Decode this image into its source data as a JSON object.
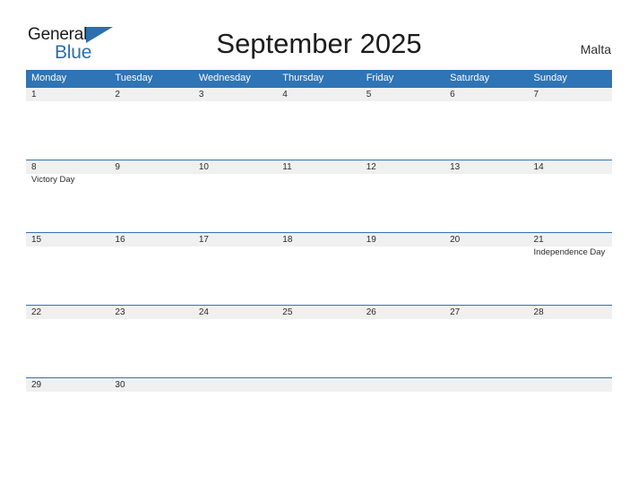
{
  "logo": {
    "word_one": "General",
    "word_two": "Blue",
    "triangle_icon": "triangle-icon",
    "brand_blue": "#2b6fad"
  },
  "header": {
    "title": "September 2025",
    "region": "Malta"
  },
  "colors": {
    "header_blue": "#2f74b5",
    "band_gray": "#f0f0f0",
    "text": "#2b2b2b"
  },
  "calendar": {
    "weekdays": [
      "Monday",
      "Tuesday",
      "Wednesday",
      "Thursday",
      "Friday",
      "Saturday",
      "Sunday"
    ],
    "weeks": [
      [
        {
          "day": "1",
          "event": ""
        },
        {
          "day": "2",
          "event": ""
        },
        {
          "day": "3",
          "event": ""
        },
        {
          "day": "4",
          "event": ""
        },
        {
          "day": "5",
          "event": ""
        },
        {
          "day": "6",
          "event": ""
        },
        {
          "day": "7",
          "event": ""
        }
      ],
      [
        {
          "day": "8",
          "event": "Victory Day"
        },
        {
          "day": "9",
          "event": ""
        },
        {
          "day": "10",
          "event": ""
        },
        {
          "day": "11",
          "event": ""
        },
        {
          "day": "12",
          "event": ""
        },
        {
          "day": "13",
          "event": ""
        },
        {
          "day": "14",
          "event": ""
        }
      ],
      [
        {
          "day": "15",
          "event": ""
        },
        {
          "day": "16",
          "event": ""
        },
        {
          "day": "17",
          "event": ""
        },
        {
          "day": "18",
          "event": ""
        },
        {
          "day": "19",
          "event": ""
        },
        {
          "day": "20",
          "event": ""
        },
        {
          "day": "21",
          "event": "Independence Day"
        }
      ],
      [
        {
          "day": "22",
          "event": ""
        },
        {
          "day": "23",
          "event": ""
        },
        {
          "day": "24",
          "event": ""
        },
        {
          "day": "25",
          "event": ""
        },
        {
          "day": "26",
          "event": ""
        },
        {
          "day": "27",
          "event": ""
        },
        {
          "day": "28",
          "event": ""
        }
      ],
      [
        {
          "day": "29",
          "event": ""
        },
        {
          "day": "30",
          "event": ""
        },
        {
          "day": "",
          "event": ""
        },
        {
          "day": "",
          "event": ""
        },
        {
          "day": "",
          "event": ""
        },
        {
          "day": "",
          "event": ""
        },
        {
          "day": "",
          "event": ""
        }
      ]
    ]
  }
}
